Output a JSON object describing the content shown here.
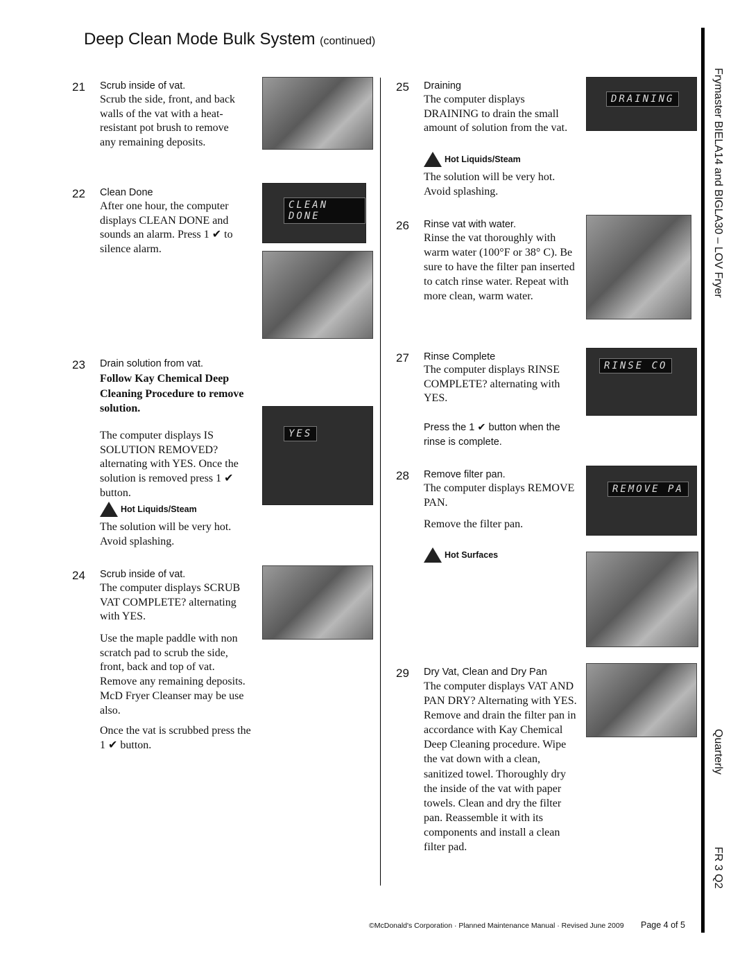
{
  "header": {
    "title": "Deep Clean Mode Bulk System",
    "suffix": "(continued)"
  },
  "sidebar": {
    "manual": "Frymaster BIELA14 and BIGLA30 – LOV Fryer",
    "frequency": "Quarterly",
    "code": "FR 3 Q2"
  },
  "footer": {
    "copyright": "©McDonald's Corporation · Planned Maintenance Manual · Revised June 2009",
    "page": "Page 4 of 5"
  },
  "warnings": {
    "hot_liquids": "Hot Liquids/Steam",
    "hot_surfaces": "Hot Surfaces"
  },
  "steps": [
    {
      "num": "21",
      "title": "Scrub inside of vat.",
      "body": "Scrub the side, front, and back walls of the vat with a heat-resistant pot brush to remove any remaining deposits."
    },
    {
      "num": "22",
      "title": "Clean Done",
      "body": "After one hour, the computer displays CLEAN DONE and sounds an alarm. Press 1 ✔ to silence alarm.",
      "display": "CLEAN DONE"
    },
    {
      "num": "23",
      "title": "Drain solution from vat.",
      "bold": "Follow Kay Chemical Deep Cleaning Procedure to remove solution.",
      "body": "The computer displays IS SOLUTION REMOVED? alternating with YES.  Once the solution is removed press 1 ✔ button.",
      "note": "The solution will be very hot. Avoid splashing.",
      "display": "YES"
    },
    {
      "num": "24",
      "title": "Scrub inside of vat.",
      "body": "The computer displays SCRUB VAT COMPLETE? alternating with YES.",
      "body2": "Use the maple paddle with non scratch pad to scrub the side, front, back and top of vat. Remove any remaining deposits. McD Fryer Cleanser may be use also.",
      "body3": "Once the vat is scrubbed press the 1 ✔ button."
    },
    {
      "num": "25",
      "title": "Draining",
      "body": "The computer displays DRAINING to drain the small amount of solution from the vat.",
      "note": "The solution will be very hot. Avoid splashing.",
      "display": "DRAINING"
    },
    {
      "num": "26",
      "title": "Rinse vat with water.",
      "body": "Rinse the vat thoroughly with warm water (100°F or 38° C). Be sure to have the filter pan inserted to catch rinse water. Repeat with more clean, warm water."
    },
    {
      "num": "27",
      "title": "Rinse Complete",
      "body": "The computer displays RINSE COMPLETE? alternating with YES.",
      "body2": "Press the 1 ✔ button when the rinse is complete.",
      "display": "RINSE CO"
    },
    {
      "num": "28",
      "title": "Remove filter pan.",
      "body": "The computer displays REMOVE PAN.",
      "body2": "Remove the filter pan.",
      "display": "REMOVE PA"
    },
    {
      "num": "29",
      "title": "Dry Vat, Clean and Dry Pan",
      "body": "The computer displays VAT AND PAN DRY? Alternating with YES. Remove and drain the filter pan in accordance with Kay Chemical Deep Cleaning procedure. Wipe the vat down with a clean, sanitized towel. Thoroughly dry the inside of the vat with paper towels. Clean and dry the filter pan. Reassemble it with its components and install a clean filter pad."
    }
  ]
}
